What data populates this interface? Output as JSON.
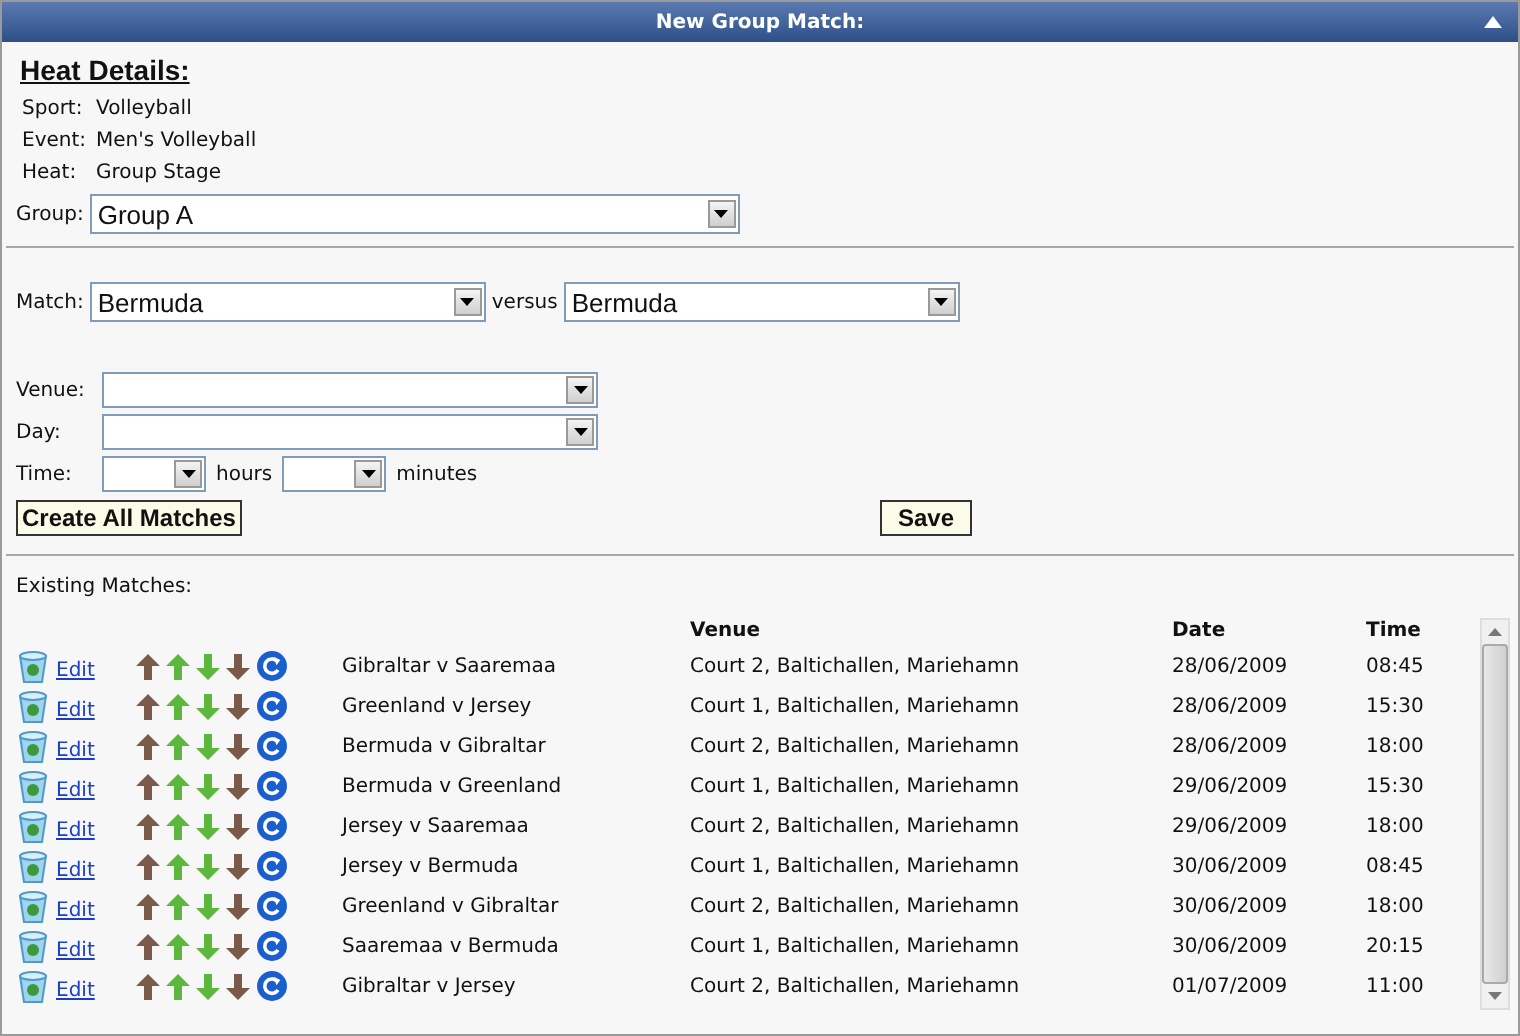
{
  "window": {
    "title": "New Group Match:"
  },
  "heat_details": {
    "heading": "Heat Details:",
    "fields": [
      {
        "label": "Sport:",
        "value": "Volleyball"
      },
      {
        "label": "Event:",
        "value": "Men's Volleyball"
      },
      {
        "label": "Heat:",
        "value": "Group Stage"
      }
    ]
  },
  "group": {
    "label": "Group:",
    "value": "Group A"
  },
  "match": {
    "label": "Match:",
    "home": "Bermuda",
    "versus": "versus",
    "away": "Bermuda"
  },
  "venue": {
    "label": "Venue:"
  },
  "day": {
    "label": "Day:"
  },
  "time": {
    "label": "Time:",
    "hours": "hours",
    "minutes": "minutes"
  },
  "buttons": {
    "create": "Create All Matches",
    "save": "Save"
  },
  "existing": {
    "title": "Existing Matches:",
    "columns": [
      "Venue",
      "Date",
      "Time"
    ],
    "rows": [
      {
        "edit": "Edit",
        "match": "Gibraltar  v  Saaremaa",
        "venue": "Court 2, Baltichallen, Mariehamn",
        "date": "28/06/2009",
        "time": "08:45"
      },
      {
        "edit": "Edit",
        "match": "Greenland  v  Jersey",
        "venue": "Court 1, Baltichallen, Mariehamn",
        "date": "28/06/2009",
        "time": "15:30"
      },
      {
        "edit": "Edit",
        "match": "Bermuda  v  Gibraltar",
        "venue": "Court 2, Baltichallen, Mariehamn",
        "date": "28/06/2009",
        "time": "18:00"
      },
      {
        "edit": "Edit",
        "match": "Bermuda  v  Greenland",
        "venue": "Court 1, Baltichallen, Mariehamn",
        "date": "29/06/2009",
        "time": "15:30"
      },
      {
        "edit": "Edit",
        "match": "Jersey  v  Saaremaa",
        "venue": "Court 2, Baltichallen, Mariehamn",
        "date": "29/06/2009",
        "time": "18:00"
      },
      {
        "edit": "Edit",
        "match": "Jersey  v  Bermuda",
        "venue": "Court 1, Baltichallen, Mariehamn",
        "date": "30/06/2009",
        "time": "08:45"
      },
      {
        "edit": "Edit",
        "match": "Greenland  v  Gibraltar",
        "venue": "Court 2, Baltichallen, Mariehamn",
        "date": "30/06/2009",
        "time": "18:00"
      },
      {
        "edit": "Edit",
        "match": "Saaremaa  v  Bermuda",
        "venue": "Court 1, Baltichallen, Mariehamn",
        "date": "30/06/2009",
        "time": "20:15"
      },
      {
        "edit": "Edit",
        "match": "Gibraltar  v  Jersey",
        "venue": "Court 2, Baltichallen, Mariehamn",
        "date": "01/07/2009",
        "time": "11:00"
      }
    ]
  }
}
